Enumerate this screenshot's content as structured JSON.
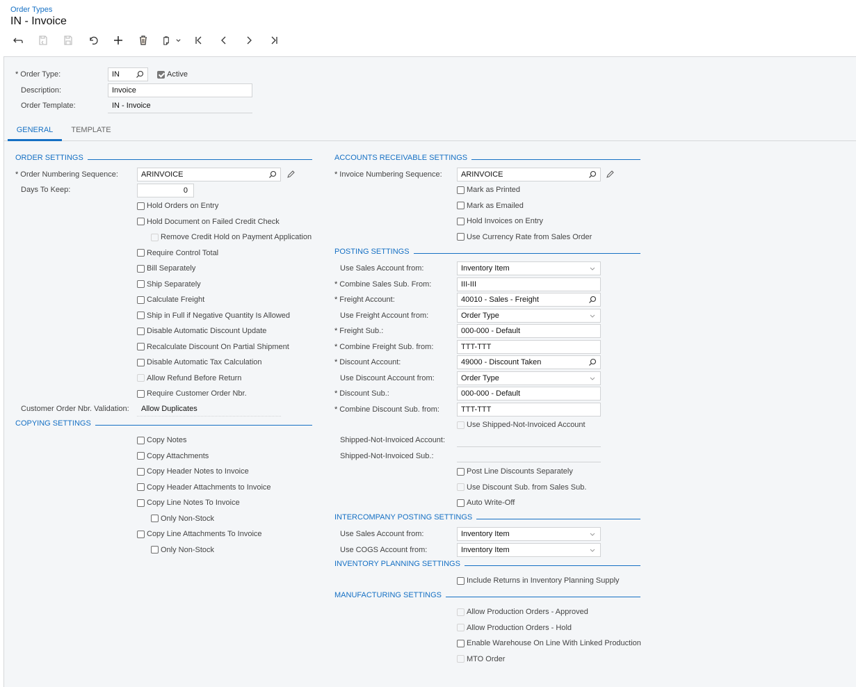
{
  "header": {
    "breadcrumb": "Order Types",
    "title": "IN - Invoice"
  },
  "toolbar": {
    "buttons": [
      {
        "name": "back",
        "icon": "back-arrow-icon",
        "enabled": true
      },
      {
        "name": "save-and-close",
        "icon": "save-close-icon",
        "enabled": false
      },
      {
        "name": "save",
        "icon": "save-icon",
        "enabled": false
      },
      {
        "name": "cancel",
        "icon": "undo-icon",
        "enabled": true
      },
      {
        "name": "add",
        "icon": "plus-icon",
        "enabled": true
      },
      {
        "name": "delete",
        "icon": "trash-icon",
        "enabled": true
      },
      {
        "name": "copy-paste",
        "icon": "clipboard-icon",
        "enabled": true
      },
      {
        "name": "first",
        "icon": "first-record-icon",
        "enabled": true
      },
      {
        "name": "previous",
        "icon": "chevron-left-icon",
        "enabled": true
      },
      {
        "name": "next",
        "icon": "chevron-right-icon",
        "enabled": true
      },
      {
        "name": "last",
        "icon": "last-record-icon",
        "enabled": true
      }
    ]
  },
  "summary": {
    "order_type_label": "Order Type:",
    "order_type_value": "IN",
    "active_label": "Active",
    "active_checked": true,
    "description_label": "Description:",
    "description_value": "Invoice",
    "order_template_label": "Order Template:",
    "order_template_value": "IN - Invoice"
  },
  "tabs": [
    {
      "label": "GENERAL",
      "active": true
    },
    {
      "label": "TEMPLATE",
      "active": false
    }
  ],
  "order_settings": {
    "title": "ORDER SETTINGS",
    "numbering_label": "Order Numbering Sequence:",
    "numbering_value": "ARINVOICE",
    "days_label": "Days To Keep:",
    "days_value": "0",
    "checkboxes": [
      {
        "label": "Hold Orders on Entry",
        "checked": false,
        "disabled": false
      },
      {
        "label": "Hold Document on Failed Credit Check",
        "checked": false,
        "disabled": false
      },
      {
        "label": "Remove Credit Hold on Payment Application",
        "checked": false,
        "disabled": true
      },
      {
        "label": "Require Control Total",
        "checked": false,
        "disabled": false
      },
      {
        "label": "Bill Separately",
        "checked": false,
        "disabled": false
      },
      {
        "label": "Ship Separately",
        "checked": false,
        "disabled": false
      },
      {
        "label": "Calculate Freight",
        "checked": false,
        "disabled": false
      },
      {
        "label": "Ship in Full if Negative Quantity Is Allowed",
        "checked": false,
        "disabled": false
      },
      {
        "label": "Disable Automatic Discount Update",
        "checked": false,
        "disabled": false
      },
      {
        "label": "Recalculate Discount On Partial Shipment",
        "checked": false,
        "disabled": false
      },
      {
        "label": "Disable Automatic Tax Calculation",
        "checked": false,
        "disabled": false
      },
      {
        "label": "Allow Refund Before Return",
        "checked": false,
        "disabled": true
      },
      {
        "label": "Require Customer Order Nbr.",
        "checked": false,
        "disabled": false
      }
    ],
    "validation_label": "Customer Order Nbr. Validation:",
    "validation_value": "Allow Duplicates"
  },
  "copying_settings": {
    "title": "COPYING SETTINGS",
    "checkboxes": [
      {
        "label": "Copy Notes",
        "checked": false
      },
      {
        "label": "Copy Attachments",
        "checked": false
      },
      {
        "label": "Copy Header Notes to Invoice",
        "checked": false
      },
      {
        "label": "Copy Header Attachments to Invoice",
        "checked": false
      },
      {
        "label": "Copy Line Notes To Invoice",
        "checked": false
      },
      {
        "label": "Only Non-Stock",
        "checked": false
      },
      {
        "label": "Copy Line Attachments To Invoice",
        "checked": false
      },
      {
        "label": "Only Non-Stock",
        "checked": false
      }
    ]
  },
  "ar_settings": {
    "title": "ACCOUNTS RECEIVABLE SETTINGS",
    "numbering_label": "Invoice Numbering Sequence:",
    "numbering_value": "ARINVOICE",
    "checkboxes": [
      {
        "label": "Mark as Printed",
        "checked": false
      },
      {
        "label": "Mark as Emailed",
        "checked": false
      },
      {
        "label": "Hold Invoices on Entry",
        "checked": false
      },
      {
        "label": "Use Currency Rate from Sales Order",
        "checked": false
      }
    ]
  },
  "posting_settings": {
    "title": "POSTING SETTINGS",
    "fields": [
      {
        "label": "Use Sales Account from:",
        "value": "Inventory Item",
        "required": false,
        "kind": "select"
      },
      {
        "label": "Combine Sales Sub. From:",
        "value": "III-III",
        "required": true,
        "kind": "text"
      },
      {
        "label": "Freight Account:",
        "value": "40010 - Sales - Freight",
        "required": true,
        "kind": "lookup"
      },
      {
        "label": "Use Freight Account from:",
        "value": "Order Type",
        "required": false,
        "kind": "select"
      },
      {
        "label": "Freight Sub.:",
        "value": "000-000 - Default",
        "required": true,
        "kind": "text"
      },
      {
        "label": "Combine Freight Sub. from:",
        "value": "TTT-TTT",
        "required": true,
        "kind": "text"
      },
      {
        "label": "Discount Account:",
        "value": "49000 - Discount Taken",
        "required": true,
        "kind": "lookup"
      },
      {
        "label": "Use Discount Account from:",
        "value": "Order Type",
        "required": false,
        "kind": "select"
      },
      {
        "label": "Discount Sub.:",
        "value": "000-000 - Default",
        "required": true,
        "kind": "text"
      },
      {
        "label": "Combine Discount Sub. from:",
        "value": "TTT-TTT",
        "required": true,
        "kind": "text"
      }
    ],
    "use_sni_label": "Use Shipped-Not-Invoiced Account",
    "sni_account_label": "Shipped-Not-Invoiced Account:",
    "sni_account_value": "",
    "sni_sub_label": "Shipped-Not-Invoiced Sub.:",
    "sni_sub_value": "",
    "checkboxes": [
      {
        "label": "Post Line Discounts Separately",
        "checked": false,
        "disabled": false
      },
      {
        "label": "Use Discount Sub. from Sales Sub.",
        "checked": false,
        "disabled": true
      },
      {
        "label": "Auto Write-Off",
        "checked": false,
        "disabled": false
      }
    ]
  },
  "intercompany_settings": {
    "title": "INTERCOMPANY POSTING SETTINGS",
    "sales_label": "Use Sales Account from:",
    "sales_value": "Inventory Item",
    "cogs_label": "Use COGS Account from:",
    "cogs_value": "Inventory Item"
  },
  "inventory_planning_settings": {
    "title": "INVENTORY PLANNING SETTINGS",
    "include_returns_label": "Include Returns in Inventory Planning Supply"
  },
  "manufacturing_settings": {
    "title": "MANUFACTURING SETTINGS",
    "checkboxes": [
      {
        "label": "Allow Production Orders - Approved",
        "checked": false,
        "disabled": true
      },
      {
        "label": "Allow Production Orders - Hold",
        "checked": false,
        "disabled": true
      },
      {
        "label": "Enable Warehouse On Line With Linked Production",
        "checked": false,
        "disabled": false
      },
      {
        "label": "MTO Order",
        "checked": false,
        "disabled": true
      }
    ]
  },
  "colors": {
    "accent": "#1570c4",
    "panel_background": "#f4f6f8",
    "border": "#d1d3d5"
  }
}
